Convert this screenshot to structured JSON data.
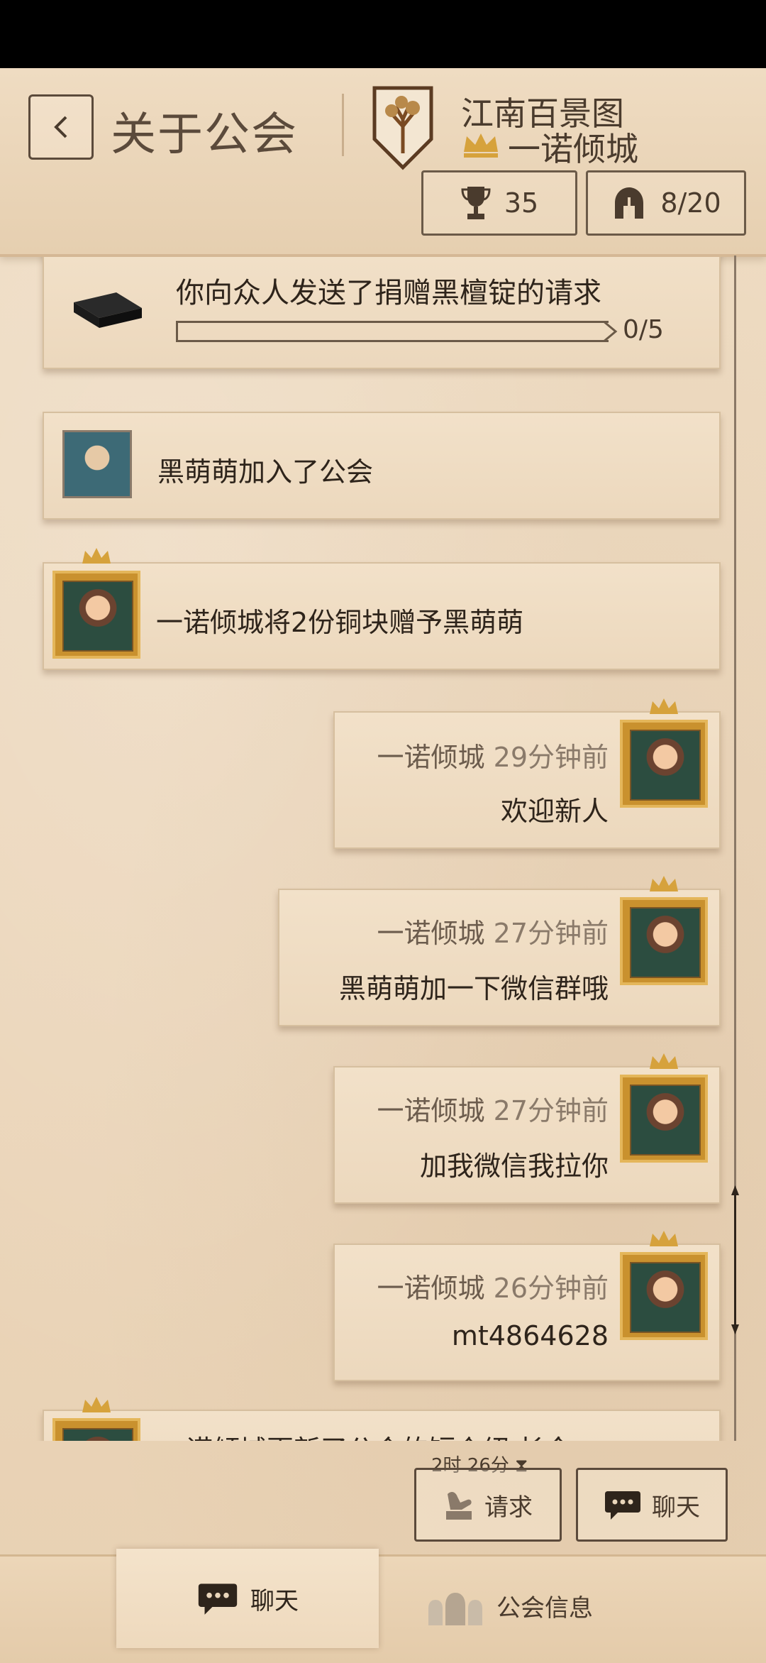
{
  "header": {
    "title": "关于公会",
    "guild_name": "江南百景图",
    "leader_name": "一诺倾城",
    "trophies": "35",
    "members": "8/20"
  },
  "messages": {
    "donation_request": {
      "text": "你向众人发送了捐赠黑檀锭的请求",
      "progress_label": "0/5",
      "progress": 0
    },
    "join_notice": {
      "text": "黑萌萌加入了公会"
    },
    "gift_notice": {
      "text": "一诺倾城将2份铜块赠予黑萌萌"
    },
    "chat": [
      {
        "sender": "一诺倾城",
        "time": "29分钟前",
        "text": "欢迎新人"
      },
      {
        "sender": "一诺倾城",
        "time": "27分钟前",
        "text": "黑萌萌加一下微信群哦"
      },
      {
        "sender": "一诺倾城",
        "time": "27分钟前",
        "text": "加我微信我拉你"
      },
      {
        "sender": "一诺倾城",
        "time": "26分钟前",
        "text": "mt4864628"
      }
    ],
    "partial_notice": {
      "text": "诺倾城更新了公会的短介绍 长今"
    }
  },
  "actions": {
    "request_timer": "2时 26分",
    "request_label": "请求",
    "chat_label": "聊天"
  },
  "tabs": [
    {
      "label": "聊天"
    },
    {
      "label": "公会信息"
    }
  ]
}
